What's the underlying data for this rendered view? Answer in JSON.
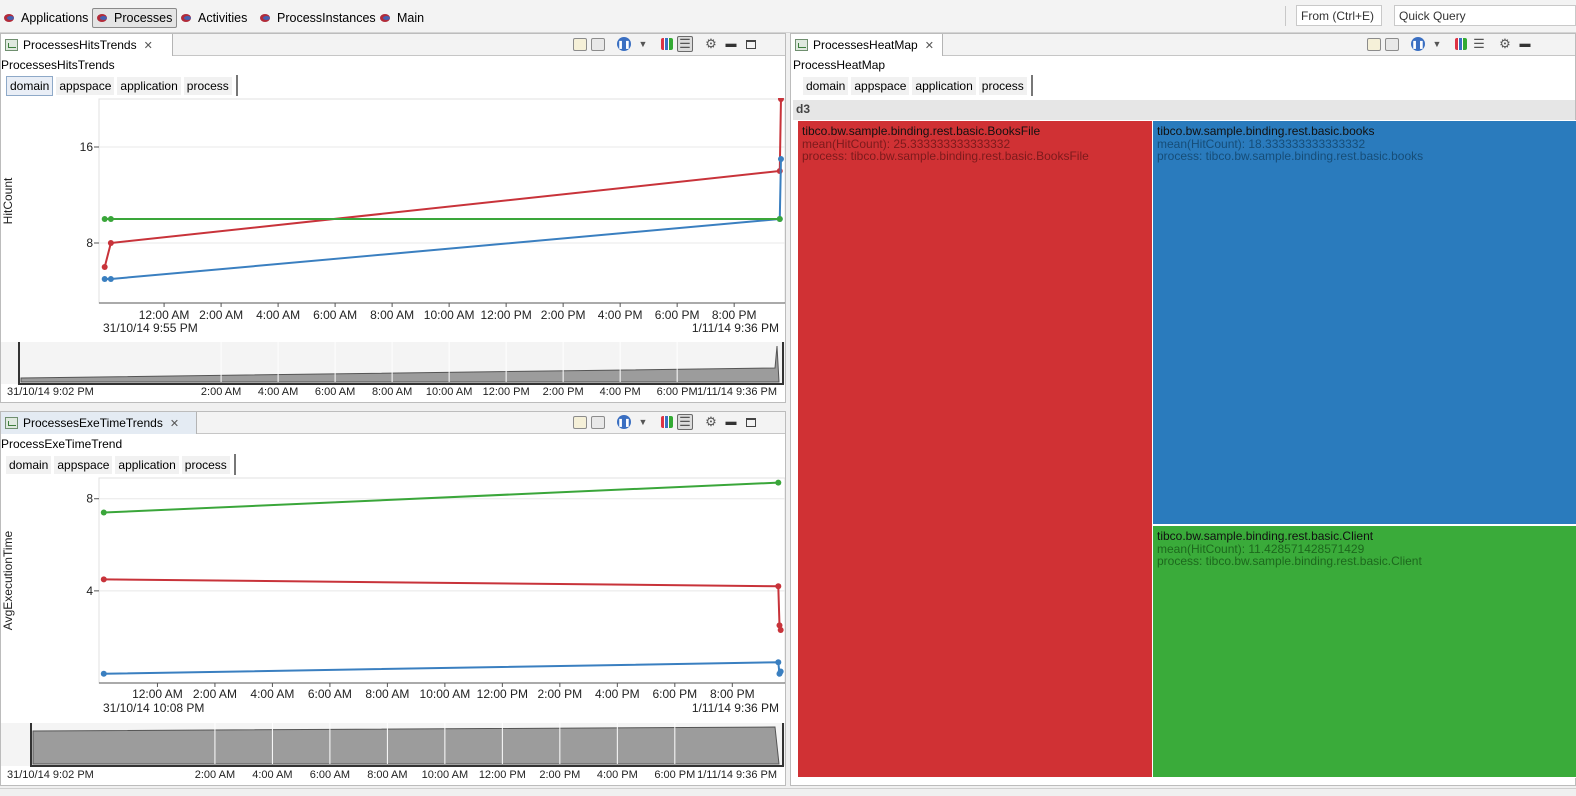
{
  "toolbar": {
    "perspectives": [
      {
        "label": "Applications",
        "active": false
      },
      {
        "label": "Processes",
        "active": true
      },
      {
        "label": "Activities",
        "active": false
      },
      {
        "label": "ProcessInstances",
        "active": false
      },
      {
        "label": "Main",
        "active": false
      }
    ],
    "from_placeholder": "From (Ctrl+E)",
    "quick_query_placeholder": "Quick Query"
  },
  "dimensions": [
    "domain",
    "appspace",
    "application",
    "process"
  ],
  "hits_view": {
    "tab_label": "ProcessesHitsTrends",
    "title": "ProcessesHitsTrends",
    "active_dimension": "domain"
  },
  "exe_view": {
    "tab_label": "ProcessesExeTimeTrends",
    "title": "ProcessExeTimeTrend"
  },
  "heat_view": {
    "tab_label": "ProcessesHeatMap",
    "title": "ProcessHeatMap",
    "root_label": "d3",
    "cells": [
      {
        "name": "tibco.bw.sample.binding.rest.basic.BooksFile",
        "mean": "mean(HitCount): 25.333333333333332",
        "process": "process: tibco.bw.sample.binding.rest.basic.BooksFile",
        "color": "#d03134",
        "sub_color": "#7c1a1c"
      },
      {
        "name": "tibco.bw.sample.binding.rest.basic.books",
        "mean": "mean(HitCount): 18.333333333333332",
        "process": "process: tibco.bw.sample.binding.rest.basic.books",
        "color": "#2a7bbd",
        "sub_color": "#164d78"
      },
      {
        "name": "tibco.bw.sample.binding.rest.basic.Client",
        "mean": "mean(HitCount): 11.428571428571429",
        "process": "process: tibco.bw.sample.binding.rest.basic.Client",
        "color": "#3aab3a",
        "sub_color": "#1d681d"
      }
    ]
  },
  "chart_data": [
    {
      "type": "line",
      "title": "",
      "ylabel": "HitCount",
      "yticks": [
        8,
        16
      ],
      "ylim": [
        3,
        20
      ],
      "xticks": [
        "12:00 AM",
        "2:00 AM",
        "4:00 AM",
        "6:00 AM",
        "8:00 AM",
        "10:00 AM",
        "12:00 PM",
        "2:00 PM",
        "4:00 PM",
        "6:00 PM",
        "8:00 PM"
      ],
      "x_start_label": "31/10/14 9:55 PM",
      "x_end_label": "1/11/14 9:36 PM",
      "series": [
        {
          "color": "#c8333a",
          "x": [
            "31/10/14 9:55 PM",
            "31/10/14 10:08 PM",
            "1/11/14 9:36 PM",
            "1/11/14 9:36 PM"
          ],
          "values": [
            6,
            8,
            14,
            20
          ]
        },
        {
          "color": "#3a7fc0",
          "x": [
            "31/10/14 9:55 PM",
            "31/10/14 10:08 PM",
            "1/11/14 9:36 PM",
            "1/11/14 9:36 PM"
          ],
          "values": [
            5,
            5,
            10,
            15
          ]
        },
        {
          "color": "#3aa63a",
          "x": [
            "31/10/14 9:55 PM",
            "31/10/14 10:08 PM",
            "1/11/14 9:36 PM"
          ],
          "values": [
            10,
            10,
            10
          ]
        }
      ],
      "overview": {
        "start_label": "31/10/14 9:02 PM",
        "end_label": "1/11/14 9:36 PM",
        "ticks": [
          "2:00 AM",
          "4:00 AM",
          "6:00 AM",
          "8:00 AM",
          "10:00 AM",
          "12:00 PM",
          "2:00 PM",
          "4:00 PM",
          "6:00 PM"
        ]
      }
    },
    {
      "type": "line",
      "title": "",
      "ylabel": "AvgExecutionTime",
      "yticks": [
        4,
        8
      ],
      "ylim": [
        0,
        8.9
      ],
      "xticks": [
        "12:00 AM",
        "2:00 AM",
        "4:00 AM",
        "6:00 AM",
        "8:00 AM",
        "10:00 AM",
        "12:00 PM",
        "2:00 PM",
        "4:00 PM",
        "6:00 PM",
        "8:00 PM"
      ],
      "x_start_label": "31/10/14 10:08 PM",
      "x_end_label": "1/11/14 9:36 PM",
      "series": [
        {
          "color": "#3aa63a",
          "x": [
            "31/10/14 10:08 PM",
            "1/11/14 9:36 PM"
          ],
          "values": [
            7.4,
            8.7
          ]
        },
        {
          "color": "#c8333a",
          "x": [
            "31/10/14 10:08 PM",
            "1/11/14 9:36 PM",
            "1/11/14 9:36 PM",
            "1/11/14 9:36 PM"
          ],
          "values": [
            4.5,
            4.2,
            2.5,
            2.3
          ]
        },
        {
          "color": "#3a7fc0",
          "x": [
            "31/10/14 10:08 PM",
            "1/11/14 9:36 PM",
            "1/11/14 9:36 PM",
            "1/11/14 9:36 PM"
          ],
          "values": [
            0.4,
            0.9,
            0.4,
            0.5
          ]
        }
      ],
      "overview": {
        "start_label": "31/10/14 9:02 PM",
        "end_label": "1/11/14 9:36 PM",
        "ticks": [
          "2:00 AM",
          "4:00 AM",
          "6:00 AM",
          "8:00 AM",
          "10:00 AM",
          "12:00 PM",
          "2:00 PM",
          "4:00 PM",
          "6:00 PM"
        ]
      }
    }
  ]
}
